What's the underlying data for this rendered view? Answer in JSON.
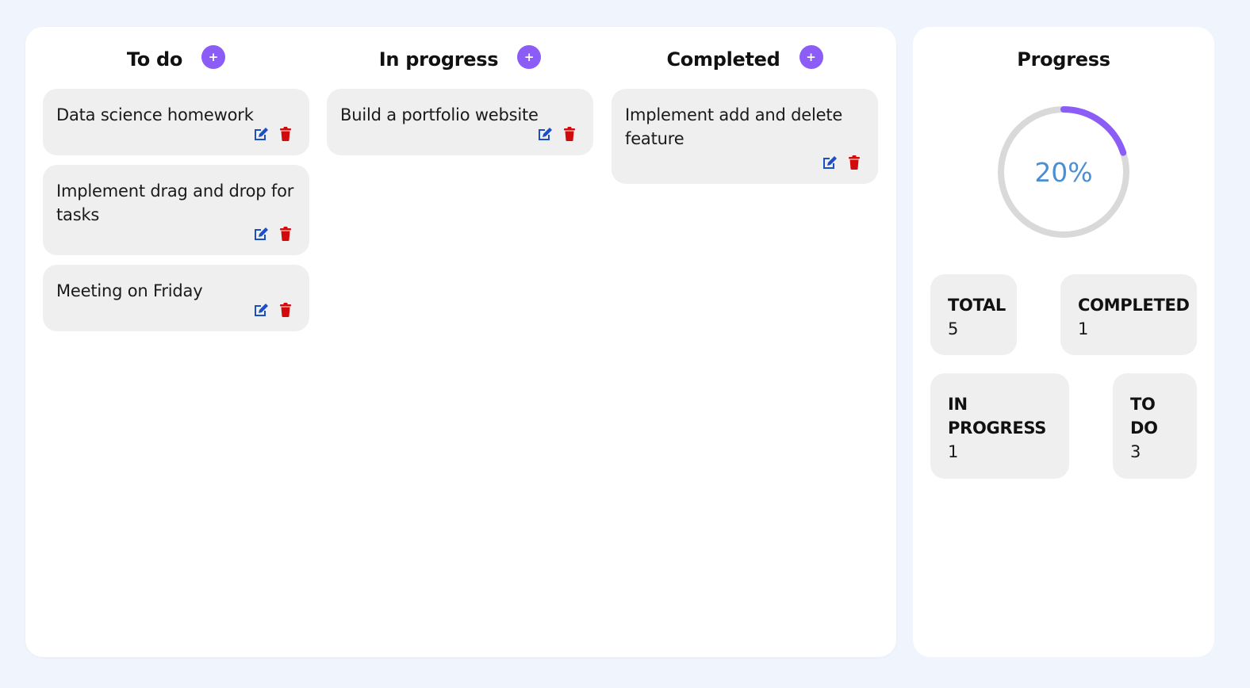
{
  "columns": [
    {
      "title": "To do",
      "add_label": "+",
      "cards": [
        {
          "text": "Data science homework"
        },
        {
          "text": "Implement drag and drop for tasks"
        },
        {
          "text": "Meeting on Friday"
        }
      ]
    },
    {
      "title": "In progress",
      "add_label": "+",
      "cards": [
        {
          "text": "Build a portfolio website"
        }
      ]
    },
    {
      "title": "Completed",
      "add_label": "+",
      "cards": [
        {
          "text": "Implement add and delete feature"
        }
      ]
    }
  ],
  "progress": {
    "title": "Progress",
    "percent_label": "20%",
    "percent": 20,
    "stats": {
      "total": {
        "label": "TOTAL",
        "value": "5"
      },
      "completed": {
        "label": "COMPLETED",
        "value": "1"
      },
      "in_progress": {
        "label": "IN PROGRESS",
        "value": "1"
      },
      "todo": {
        "label": "TO DO",
        "value": "3"
      }
    }
  },
  "icons": {
    "add": "plus-icon",
    "edit": "edit-icon",
    "delete": "trash-icon"
  },
  "colors": {
    "accent": "#8b5cf6",
    "edit": "#1d4fc4",
    "delete": "#d10b0b",
    "ring_track": "#d9d9d9",
    "percent_text": "#4a8fd1"
  }
}
